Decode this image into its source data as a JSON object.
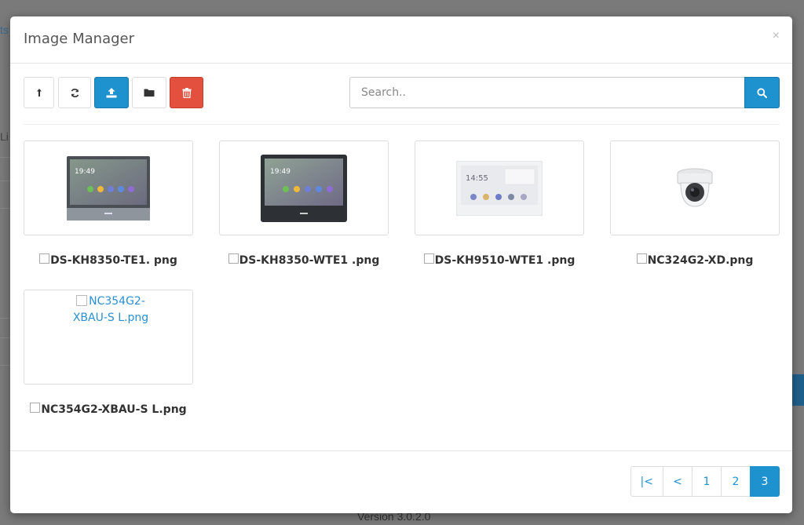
{
  "background": {
    "fragment_top": "ts",
    "fragment_mid": "Li",
    "version": "Version 3.0.2.0"
  },
  "modal": {
    "title": "Image Manager",
    "close": "×"
  },
  "toolbar": {
    "buttons": [
      {
        "name": "parent-button",
        "icon": "level-up-icon"
      },
      {
        "name": "refresh-button",
        "icon": "refresh-icon"
      },
      {
        "name": "upload-button",
        "icon": "upload-icon"
      },
      {
        "name": "new-folder-button",
        "icon": "folder-icon"
      },
      {
        "name": "delete-button",
        "icon": "trash-icon"
      }
    ]
  },
  "search": {
    "placeholder": "Search..",
    "button_icon": "search-icon"
  },
  "images": [
    {
      "filename": "DS-KH8350-TE1. png"
    },
    {
      "filename": "DS-KH8350-WTE1 .png"
    },
    {
      "filename": "DS-KH9510-WTE1 .png"
    },
    {
      "filename": "NC324G2-XD.png"
    },
    {
      "filename": "NC354G2-XBAU-S L.png",
      "alt": "NC354G2-XBAU-S L.png"
    }
  ],
  "pagination": {
    "first": "|<",
    "prev": "<",
    "pages": [
      "1",
      "2",
      "3"
    ],
    "active": "3"
  },
  "colors": {
    "primary": "#1e91cf",
    "danger": "#e3503e"
  }
}
